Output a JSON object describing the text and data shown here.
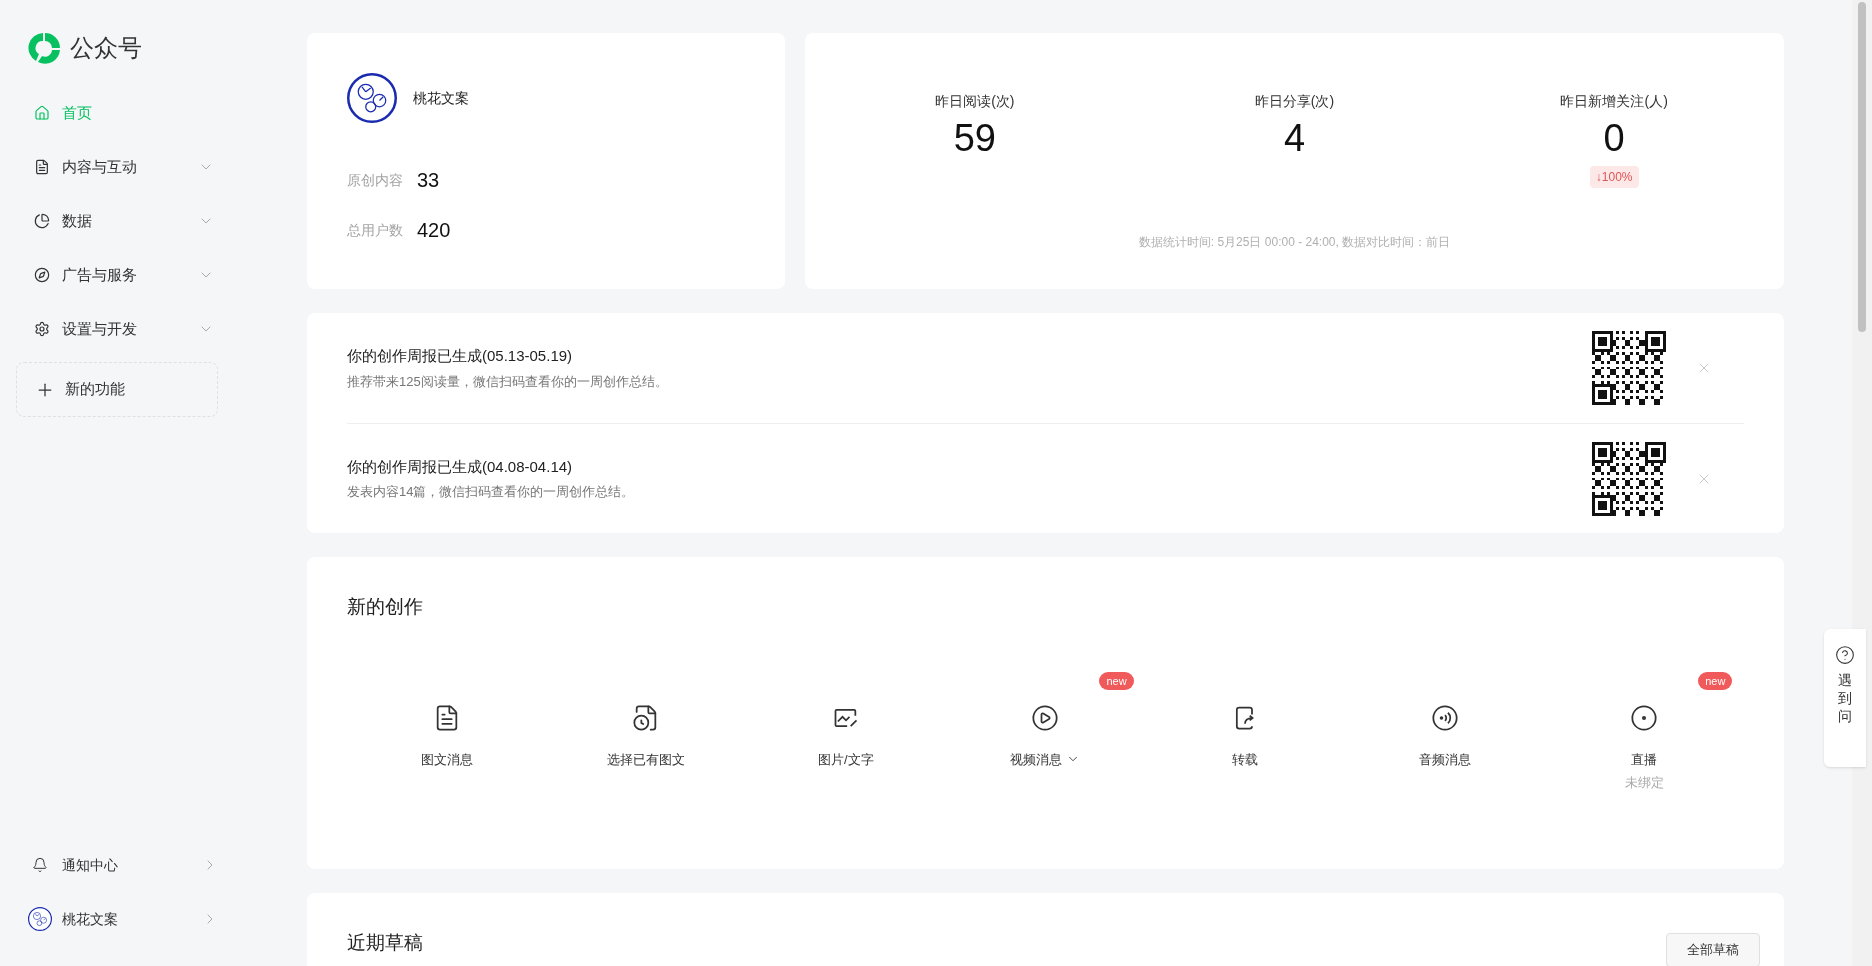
{
  "brand": {
    "name": "公众号"
  },
  "sidebar": {
    "items": [
      {
        "label": "首页",
        "kind": "page",
        "selected": true
      },
      {
        "label": "内容与互动",
        "kind": "group",
        "selected": false
      },
      {
        "label": "数据",
        "kind": "group",
        "selected": false
      },
      {
        "label": "广告与服务",
        "kind": "group",
        "selected": false
      },
      {
        "label": "设置与开发",
        "kind": "group",
        "selected": false
      }
    ],
    "new_feature": "新的功能",
    "notifications": "通知中心",
    "account": "桃花文案"
  },
  "profile": {
    "name": "桃花文案",
    "stats": [
      {
        "label": "原创内容",
        "value": "33"
      },
      {
        "label": "总用户数",
        "value": "420"
      }
    ]
  },
  "overview": {
    "stats": [
      {
        "label": "昨日阅读(次)",
        "value": "59"
      },
      {
        "label": "昨日分享(次)",
        "value": "4"
      },
      {
        "label": "昨日新增关注(人)",
        "value": "0",
        "change": "↓100%"
      }
    ],
    "note": "数据统计时间: 5月25日 00:00 - 24:00, 数据对比时间：前日"
  },
  "reports": [
    {
      "title": "你的创作周报已生成(05.13-05.19)",
      "desc": "推荐带来125阅读量，微信扫码查看你的一周创作总结。"
    },
    {
      "title": "你的创作周报已生成(04.08-04.14)",
      "desc": "发表内容14篇，微信扫码查看你的一周创作总结。"
    }
  ],
  "create": {
    "title": "新的创作",
    "items": [
      {
        "label": "图文消息",
        "kind": "article"
      },
      {
        "label": "选择已有图文",
        "kind": "existing"
      },
      {
        "label": "图片/文字",
        "kind": "image"
      },
      {
        "label": "视频消息",
        "kind": "video",
        "badge": "new",
        "dropdown": true
      },
      {
        "label": "转载",
        "kind": "repost"
      },
      {
        "label": "音频消息",
        "kind": "audio"
      },
      {
        "label": "直播",
        "kind": "live",
        "badge": "new",
        "sub": "未绑定"
      }
    ]
  },
  "drafts": {
    "title": "近期草稿",
    "button": "全部草稿"
  },
  "help": {
    "label": "遇到问"
  }
}
